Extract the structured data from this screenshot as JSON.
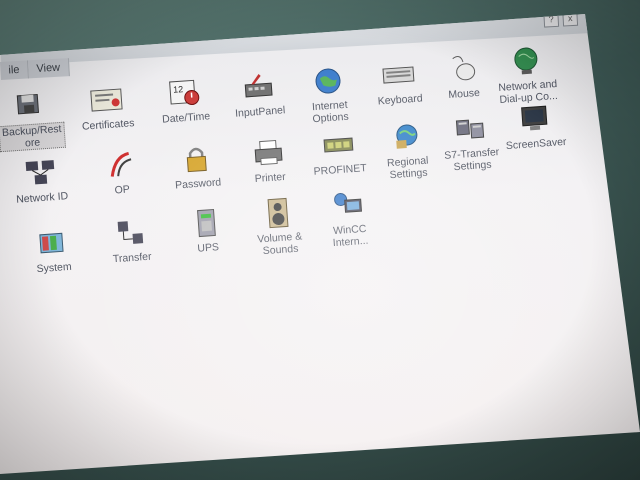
{
  "menu": {
    "file_label": "ile",
    "view_label": "View"
  },
  "window_buttons": [
    "?",
    "x"
  ],
  "items": [
    {
      "label": "Backup/Rest\nore",
      "icon": "backup-icon"
    },
    {
      "label": "Certificates",
      "icon": "certificates-icon"
    },
    {
      "label": "Date/Time",
      "icon": "calendar-clock-icon"
    },
    {
      "label": "InputPanel",
      "icon": "input-panel-icon"
    },
    {
      "label": "Internet\nOptions",
      "icon": "globe-icon"
    },
    {
      "label": "Keyboard",
      "icon": "keyboard-icon"
    },
    {
      "label": "Mouse",
      "icon": "mouse-icon"
    },
    {
      "label": "Network and\nDial-up Co...",
      "icon": "network-globe-icon"
    },
    {
      "label": "Network ID",
      "icon": "network-id-icon"
    },
    {
      "label": "OP",
      "icon": "op-icon"
    },
    {
      "label": "Password",
      "icon": "padlock-icon"
    },
    {
      "label": "Printer",
      "icon": "printer-icon"
    },
    {
      "label": "PROFINET",
      "icon": "profinet-icon"
    },
    {
      "label": "Regional\nSettings",
      "icon": "regional-globe-icon"
    },
    {
      "label": "S7-Transfer\nSettings",
      "icon": "s7-transfer-icon"
    },
    {
      "label": "ScreenSaver",
      "icon": "monitor-icon"
    },
    {
      "label": "System",
      "icon": "system-icon"
    },
    {
      "label": "Transfer",
      "icon": "transfer-icon"
    },
    {
      "label": "UPS",
      "icon": "ups-icon"
    },
    {
      "label": "Volume &\nSounds",
      "icon": "speaker-icon"
    },
    {
      "label": "WinCC\nIntern...",
      "icon": "wincc-icon"
    }
  ]
}
